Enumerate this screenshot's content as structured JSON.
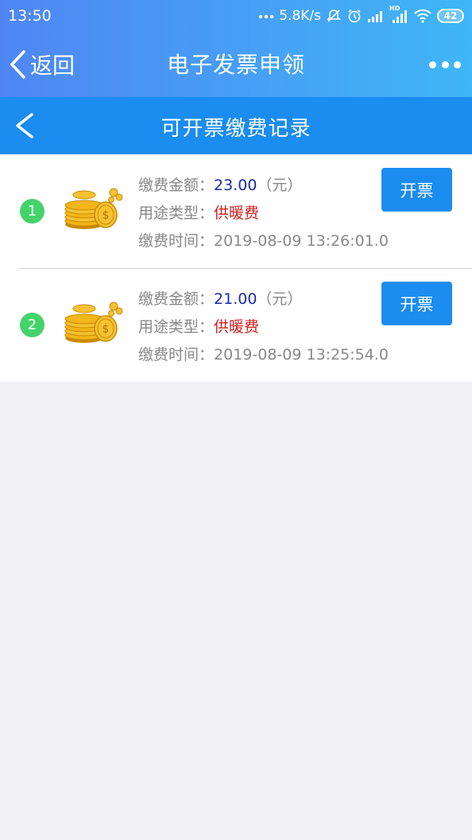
{
  "status_bar": {
    "time": "13:50",
    "network_speed": "5.8K/s",
    "hd_label": "HD",
    "battery": "42",
    "icons": [
      "more-dots-icon",
      "mute-icon",
      "alarm-icon",
      "signal-icon",
      "signal-hd-icon",
      "wifi-icon",
      "battery-icon"
    ]
  },
  "header": {
    "back_label": "返回",
    "title": "电子发票申领",
    "more_icon": "more-dots-icon"
  },
  "subheader": {
    "title": "可开票缴费记录",
    "back_icon": "chevron-left-icon"
  },
  "colors": {
    "header_gradient_start": "#4f86f4",
    "header_gradient_end": "#3fb6f6",
    "subheader_bg": "#1b8cf0",
    "button_bg": "#1b8cf0",
    "badge_green": "#44d36b",
    "amount_blue": "#1b2aa6",
    "type_red": "#cc1f1f",
    "page_bg": "#efeff4"
  },
  "records": [
    {
      "index": "1",
      "amount_label": "缴费金额：",
      "amount": "23.00",
      "amount_unit": "（元）",
      "type_label": "用途类型：",
      "type": "供暖费",
      "time_label": "缴费时间：",
      "time": "2019-08-09 13:26:01.0",
      "button": "开票",
      "icon": "gold-coins-icon"
    },
    {
      "index": "2",
      "amount_label": "缴费金额：",
      "amount": "21.00",
      "amount_unit": "（元）",
      "type_label": "用途类型：",
      "type": "供暖费",
      "time_label": "缴费时间：",
      "time": "2019-08-09 13:25:54.0",
      "button": "开票",
      "icon": "gold-coins-icon"
    }
  ]
}
